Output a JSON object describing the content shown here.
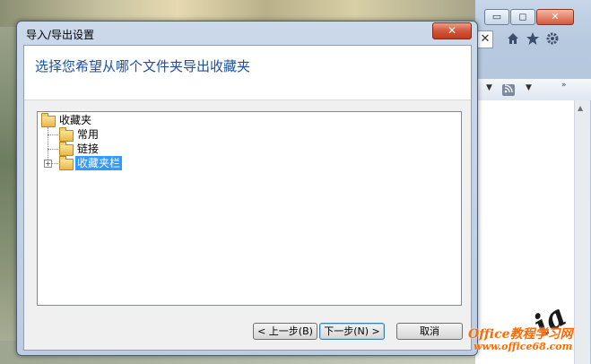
{
  "dialog": {
    "title": "导入/导出设置",
    "close_label": "✕",
    "heading": "选择您希望从哪个文件夹导出收藏夹",
    "tree": {
      "root": "收藏夹",
      "children": [
        {
          "label": "常用",
          "expandable": false,
          "selected": false
        },
        {
          "label": "链接",
          "expandable": false,
          "selected": false
        },
        {
          "label": "收藏夹栏",
          "expandable": true,
          "selected": true
        }
      ]
    },
    "buttons": {
      "back": "< 上一步(B)",
      "next": "下一步(N) >",
      "cancel": "取消"
    }
  },
  "browser": {
    "minimize": "▭",
    "restore": "◻",
    "close": "✕",
    "tab_close": "✕",
    "icons": [
      "home-icon",
      "star-icon",
      "gear-icon"
    ],
    "feed_icon": "rss-icon"
  },
  "watermark": {
    "signature": "ia",
    "site_line1": "Office教程学习网",
    "site_line2": "www.office68.com"
  },
  "colors": {
    "heading": "#1d4fa0",
    "selection": "#3399ff",
    "close_button": "#c13a1d",
    "watermark_site": "#ff6a00"
  }
}
